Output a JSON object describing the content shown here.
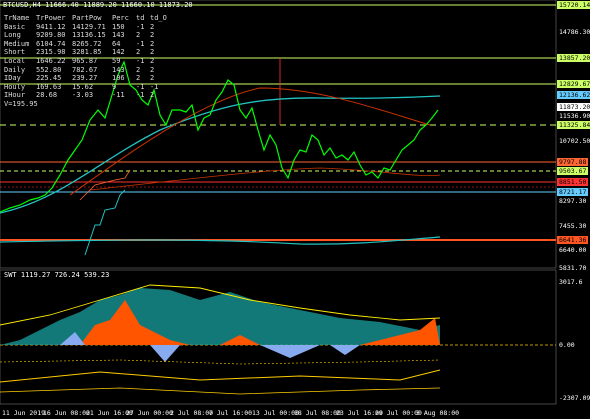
{
  "header": {
    "symbol_line": "BTCUSD,H4  11666.40 11889.20 11660.10 11873.20"
  },
  "table": {
    "headers": [
      "TrName",
      "TrPower",
      "PartPow",
      "Perc",
      "td",
      "td_O"
    ],
    "rows": [
      [
        "Basic",
        "9411.12",
        "14129.71",
        "150",
        "-1",
        "2"
      ],
      [
        "Long",
        "9209.80",
        "13136.15",
        "143",
        "2",
        "2"
      ],
      [
        "Medium",
        "6104.74",
        "8265.72",
        "64",
        "-1",
        "2"
      ],
      [
        "Short",
        "2315.98",
        "3281.85",
        "142",
        "2",
        "2"
      ],
      [
        "Local",
        "1646.22",
        "965.87",
        "59",
        "-1",
        "2"
      ],
      [
        "Daily",
        "552.80",
        "782.67",
        "143",
        "2",
        "2"
      ],
      [
        "IDay",
        "225.45",
        "239.27",
        "106",
        "2",
        "2"
      ],
      [
        "Houly",
        "169.63",
        "15.62",
        "9",
        "-1",
        "-1"
      ],
      [
        "IHour",
        "28.68",
        "-3.03",
        "-11",
        "-1",
        "2"
      ],
      [
        "V=195.95",
        "",
        "",
        "",
        "",
        ""
      ]
    ]
  },
  "price_axis": {
    "labels": [
      "15720.14",
      "14786.30",
      "13857.20",
      "12829.67",
      "12136.62",
      "11873.20",
      "11536.90",
      "11325.84",
      "10702.50",
      "9797.88",
      "9503.67",
      "8851.50",
      "8721.17",
      "8297.30",
      "7455.30",
      "6641.36",
      "6640.00",
      "5831.70"
    ],
    "tags": [
      {
        "text": "15720.14",
        "bg": "#ccff66"
      },
      {
        "text": "13857.20",
        "bg": "#ccff66"
      },
      {
        "text": "12829.67",
        "bg": "#ccff66"
      },
      {
        "text": "12136.62",
        "bg": "#66ccff"
      },
      {
        "text": "11873.20",
        "bg": "#ffffff"
      },
      {
        "text": "11325.84",
        "bg": "#ccff66"
      },
      {
        "text": "9797.88",
        "bg": "#ff6633"
      },
      {
        "text": "9503.67",
        "bg": "#ccff66"
      },
      {
        "text": "8851.50",
        "bg": "#ff3333"
      },
      {
        "text": "8721.17",
        "bg": "#66ccff"
      },
      {
        "text": "6641.36",
        "bg": "#ff5522"
      }
    ]
  },
  "sub_window": {
    "title": "SWT 1119.27 726.24 539.23",
    "axis_labels": [
      "3017.6",
      "0.00",
      "-2307.09"
    ]
  },
  "date_axis": {
    "labels": [
      "11 Jun 2019",
      "16 Jun 08:00",
      "21 Jun 16:00",
      "27 Jun 00:00",
      "2 Jul 08:00",
      "7 Jul 16:00",
      "13 Jul 00:00",
      "18 Jul 08:00",
      "23 Jul 16:00",
      "29 Jul 00:00",
      "3 Aug 08:00"
    ]
  },
  "colors": {
    "candles": "#00ff00",
    "ma_cyan": "#22c3c3",
    "ma_red": "#cc3300",
    "level_yellow": "#ccff66",
    "level_red": "#ff5522"
  }
}
